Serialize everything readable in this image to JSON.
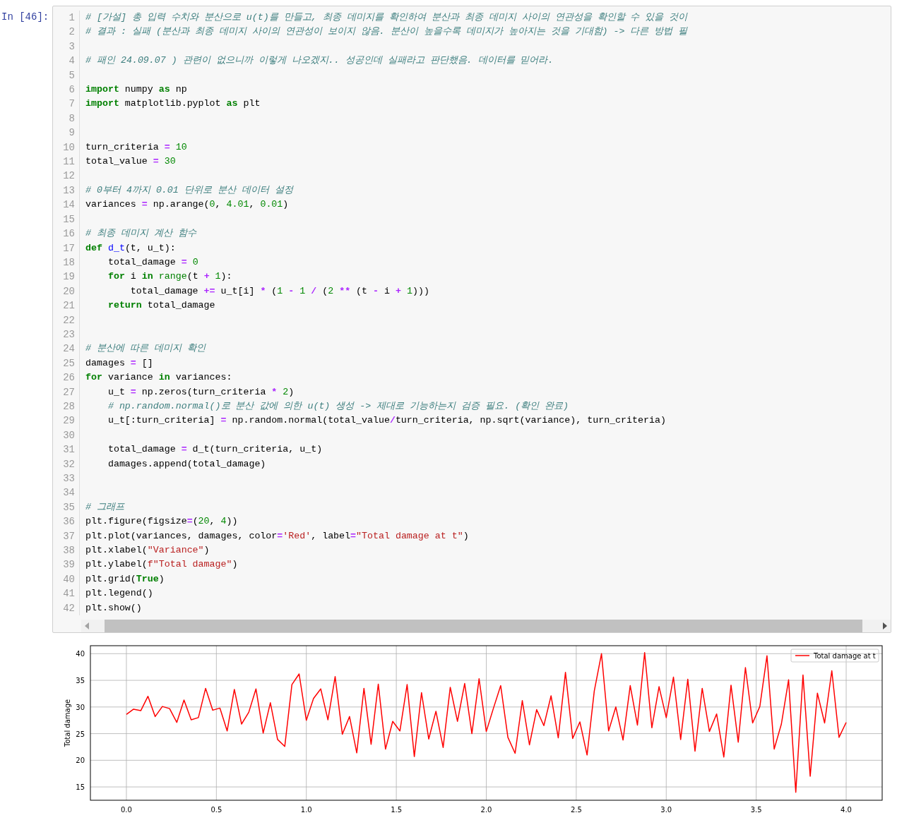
{
  "prompt": "In [46]:",
  "code": {
    "lines": [
      {
        "number": "1",
        "segments": [
          {
            "kind": "comment",
            "text": "# [가설] 총 입력 수치와 분산으로 u(t)를 만들고, 최종 데미지를 확인하여 분산과 최종 데미지 사이의 연관성을 확인할 수 있을 것이"
          }
        ]
      },
      {
        "number": "2",
        "segments": [
          {
            "kind": "comment",
            "text": "# 결과 : 실패 (분산과 최종 데미지 사이의 연관성이 보이지 않음. 분산이 높을수록 데미지가 높아지는 것을 기대함) -> 다른 방법 필"
          }
        ]
      },
      {
        "number": "3"
      },
      {
        "number": "4",
        "segments": [
          {
            "kind": "comment",
            "text": "# 패인 24.09.07 ) 관련이 없으니까 이렇게 나오겠지.. 성공인데 실패라고 판단했음. 데이터를 믿어라."
          }
        ]
      },
      {
        "number": "5"
      },
      {
        "number": "6",
        "segments": [
          {
            "kind": "keyword",
            "text": "import"
          },
          {
            "kind": "name",
            "text": " numpy "
          },
          {
            "kind": "keyword",
            "text": "as"
          },
          {
            "kind": "name",
            "text": " np"
          }
        ]
      },
      {
        "number": "7",
        "segments": [
          {
            "kind": "keyword",
            "text": "import"
          },
          {
            "kind": "name",
            "text": " matplotlib.pyplot "
          },
          {
            "kind": "keyword",
            "text": "as"
          },
          {
            "kind": "name",
            "text": " plt"
          }
        ]
      },
      {
        "number": "8"
      },
      {
        "number": "9"
      },
      {
        "number": "10",
        "segments": [
          {
            "kind": "name",
            "text": "turn_criteria "
          },
          {
            "kind": "operator",
            "text": "= "
          },
          {
            "kind": "number",
            "text": "10"
          }
        ]
      },
      {
        "number": "11",
        "segments": [
          {
            "kind": "name",
            "text": "total_value "
          },
          {
            "kind": "operator",
            "text": "= "
          },
          {
            "kind": "number",
            "text": "30"
          }
        ]
      },
      {
        "number": "12"
      },
      {
        "number": "13",
        "segments": [
          {
            "kind": "comment",
            "text": "# 0부터 4까지 0.01 단위로 분산 데이터 설정"
          }
        ]
      },
      {
        "number": "14",
        "segments": [
          {
            "kind": "name",
            "text": "variances "
          },
          {
            "kind": "operator",
            "text": "="
          },
          {
            "kind": "name",
            "text": " np.arange("
          },
          {
            "kind": "number",
            "text": "0"
          },
          {
            "kind": "name",
            "text": ", "
          },
          {
            "kind": "number",
            "text": "4.01"
          },
          {
            "kind": "name",
            "text": ", "
          },
          {
            "kind": "number",
            "text": "0.01"
          },
          {
            "kind": "name",
            "text": ")"
          }
        ]
      },
      {
        "number": "15"
      },
      {
        "number": "16",
        "segments": [
          {
            "kind": "comment",
            "text": "# 최종 데미지 계산 함수"
          }
        ]
      },
      {
        "number": "17",
        "segments": [
          {
            "kind": "keyword",
            "text": "def "
          },
          {
            "kind": "function",
            "text": "d_t"
          },
          {
            "kind": "name",
            "text": "(t, u_t):"
          }
        ]
      },
      {
        "number": "18",
        "segments": [
          {
            "kind": "name",
            "text": "    total_damage "
          },
          {
            "kind": "operator",
            "text": "= "
          },
          {
            "kind": "number",
            "text": "0"
          }
        ]
      },
      {
        "number": "19",
        "segments": [
          {
            "kind": "keyword",
            "text": "    for"
          },
          {
            "kind": "name",
            "text": " i "
          },
          {
            "kind": "keyword",
            "text": "in "
          },
          {
            "kind": "builtin",
            "text": "range"
          },
          {
            "kind": "name",
            "text": "(t "
          },
          {
            "kind": "operator",
            "text": "+ "
          },
          {
            "kind": "number",
            "text": "1"
          },
          {
            "kind": "name",
            "text": "):"
          }
        ]
      },
      {
        "number": "20",
        "segments": [
          {
            "kind": "name",
            "text": "        total_damage "
          },
          {
            "kind": "operator",
            "text": "+="
          },
          {
            "kind": "name",
            "text": " u_t[i] "
          },
          {
            "kind": "operator",
            "text": "*"
          },
          {
            "kind": "name",
            "text": " ("
          },
          {
            "kind": "number",
            "text": "1 "
          },
          {
            "kind": "operator",
            "text": "- "
          },
          {
            "kind": "number",
            "text": "1 "
          },
          {
            "kind": "operator",
            "text": "/"
          },
          {
            "kind": "name",
            "text": " ("
          },
          {
            "kind": "number",
            "text": "2 "
          },
          {
            "kind": "operator",
            "text": "**"
          },
          {
            "kind": "name",
            "text": " (t "
          },
          {
            "kind": "operator",
            "text": "-"
          },
          {
            "kind": "name",
            "text": " i "
          },
          {
            "kind": "operator",
            "text": "+ "
          },
          {
            "kind": "number",
            "text": "1"
          },
          {
            "kind": "name",
            "text": ")))"
          }
        ]
      },
      {
        "number": "21",
        "segments": [
          {
            "kind": "keyword",
            "text": "    return"
          },
          {
            "kind": "name",
            "text": " total_damage"
          }
        ]
      },
      {
        "number": "22"
      },
      {
        "number": "23"
      },
      {
        "number": "24",
        "segments": [
          {
            "kind": "comment",
            "text": "# 분산에 따른 데미지 확인"
          }
        ]
      },
      {
        "number": "25",
        "segments": [
          {
            "kind": "name",
            "text": "damages "
          },
          {
            "kind": "operator",
            "text": "="
          },
          {
            "kind": "name",
            "text": " []"
          }
        ]
      },
      {
        "number": "26",
        "segments": [
          {
            "kind": "keyword",
            "text": "for"
          },
          {
            "kind": "name",
            "text": " variance "
          },
          {
            "kind": "keyword",
            "text": "in"
          },
          {
            "kind": "name",
            "text": " variances:"
          }
        ]
      },
      {
        "number": "27",
        "segments": [
          {
            "kind": "name",
            "text": "    u_t "
          },
          {
            "kind": "operator",
            "text": "="
          },
          {
            "kind": "name",
            "text": " np.zeros(turn_criteria "
          },
          {
            "kind": "operator",
            "text": "* "
          },
          {
            "kind": "number",
            "text": "2"
          },
          {
            "kind": "name",
            "text": ")"
          }
        ]
      },
      {
        "number": "28",
        "segments": [
          {
            "kind": "comment",
            "text": "    # np.random.normal()로 분산 값에 의한 u(t) 생성 -> 제대로 기능하는지 검증 필요. (확인 완료)"
          }
        ]
      },
      {
        "number": "29",
        "segments": [
          {
            "kind": "name",
            "text": "    u_t[:turn_criteria] "
          },
          {
            "kind": "operator",
            "text": "="
          },
          {
            "kind": "name",
            "text": " np.random.normal(total_value"
          },
          {
            "kind": "operator",
            "text": "/"
          },
          {
            "kind": "name",
            "text": "turn_criteria, np.sqrt(variance), turn_criteria)"
          }
        ]
      },
      {
        "number": "30"
      },
      {
        "number": "31",
        "segments": [
          {
            "kind": "name",
            "text": "    total_damage "
          },
          {
            "kind": "operator",
            "text": "="
          },
          {
            "kind": "name",
            "text": " d_t(turn_criteria, u_t)"
          }
        ]
      },
      {
        "number": "32",
        "segments": [
          {
            "kind": "name",
            "text": "    damages.append(total_damage)"
          }
        ]
      },
      {
        "number": "33"
      },
      {
        "number": "34"
      },
      {
        "number": "35",
        "segments": [
          {
            "kind": "comment",
            "text": "# 그래프"
          }
        ]
      },
      {
        "number": "36",
        "segments": [
          {
            "kind": "name",
            "text": "plt.figure(figsize"
          },
          {
            "kind": "operator",
            "text": "="
          },
          {
            "kind": "name",
            "text": "("
          },
          {
            "kind": "number",
            "text": "20"
          },
          {
            "kind": "name",
            "text": ", "
          },
          {
            "kind": "number",
            "text": "4"
          },
          {
            "kind": "name",
            "text": "))"
          }
        ]
      },
      {
        "number": "37",
        "segments": [
          {
            "kind": "name",
            "text": "plt.plot(variances, damages, color"
          },
          {
            "kind": "operator",
            "text": "="
          },
          {
            "kind": "string",
            "text": "'Red'"
          },
          {
            "kind": "name",
            "text": ", label"
          },
          {
            "kind": "operator",
            "text": "="
          },
          {
            "kind": "string",
            "text": "\"Total damage at t\""
          },
          {
            "kind": "name",
            "text": ")"
          }
        ]
      },
      {
        "number": "38",
        "segments": [
          {
            "kind": "name",
            "text": "plt.xlabel("
          },
          {
            "kind": "string",
            "text": "\"Variance\""
          },
          {
            "kind": "name",
            "text": ")"
          }
        ]
      },
      {
        "number": "39",
        "segments": [
          {
            "kind": "name",
            "text": "plt.ylabel("
          },
          {
            "kind": "string",
            "text": "f\"Total damage\""
          },
          {
            "kind": "name",
            "text": ")"
          }
        ]
      },
      {
        "number": "40",
        "segments": [
          {
            "kind": "name",
            "text": "plt.grid("
          },
          {
            "kind": "keyword",
            "text": "True"
          },
          {
            "kind": "name",
            "text": ")"
          }
        ]
      },
      {
        "number": "41",
        "segments": [
          {
            "kind": "name",
            "text": "plt.legend()"
          }
        ]
      },
      {
        "number": "42",
        "segments": [
          {
            "kind": "name",
            "text": "plt.show()"
          }
        ]
      }
    ]
  },
  "output": {
    "chart_data": {
      "type": "line",
      "grid": true,
      "ylabel": "Total damage",
      "xlim": [
        -0.2,
        4.2
      ],
      "ylim": [
        12.5,
        41.5
      ],
      "xticks": [
        {
          "value": 0,
          "label": "0.0"
        },
        {
          "value": 0.5,
          "label": "0.5"
        },
        {
          "value": 1,
          "label": "1.0"
        },
        {
          "value": 1.5,
          "label": "1.5"
        },
        {
          "value": 2,
          "label": "2.0"
        },
        {
          "value": 2.5,
          "label": "2.5"
        },
        {
          "value": 3,
          "label": "3.0"
        },
        {
          "value": 3.5,
          "label": "3.5"
        },
        {
          "value": 4,
          "label": "4.0"
        }
      ],
      "yticks": [
        15,
        20,
        25,
        30,
        35,
        40
      ],
      "x": [
        0,
        0.04,
        0.08,
        0.12,
        0.16,
        0.2,
        0.24,
        0.28,
        0.32,
        0.36,
        0.4,
        0.44,
        0.48,
        0.52,
        0.56,
        0.6,
        0.64,
        0.68,
        0.72,
        0.76,
        0.8,
        0.84,
        0.88,
        0.92,
        0.96,
        1,
        1.04,
        1.08,
        1.12,
        1.16,
        1.2,
        1.24,
        1.28,
        1.32,
        1.36,
        1.4,
        1.44,
        1.48,
        1.52,
        1.56,
        1.6,
        1.64,
        1.68,
        1.72,
        1.76,
        1.8,
        1.84,
        1.88,
        1.92,
        1.96,
        2,
        2.04,
        2.08,
        2.12,
        2.16,
        2.2,
        2.24,
        2.28,
        2.32,
        2.36,
        2.4,
        2.44,
        2.48,
        2.52,
        2.56,
        2.6,
        2.64,
        2.68,
        2.72,
        2.76,
        2.8,
        2.84,
        2.88,
        2.92,
        2.96,
        3,
        3.04,
        3.08,
        3.12,
        3.16,
        3.2,
        3.24,
        3.28,
        3.32,
        3.36,
        3.4,
        3.44,
        3.48,
        3.52,
        3.56,
        3.6,
        3.64,
        3.68,
        3.72,
        3.76,
        3.8,
        3.84,
        3.88,
        3.92,
        3.96,
        4
      ],
      "series": [
        {
          "name": "Total damage at t",
          "color": "#ff0000",
          "values": [
            28.6,
            29.6,
            29.3,
            32.0,
            28.2,
            30.1,
            29.7,
            27.1,
            31.3,
            27.6,
            28.0,
            33.5,
            29.4,
            29.8,
            25.5,
            33.3,
            26.8,
            29.0,
            33.4,
            25.1,
            30.8,
            23.9,
            22.6,
            34.2,
            36.2,
            27.5,
            31.6,
            33.4,
            27.6,
            35.7,
            24.9,
            28.2,
            21.4,
            33.5,
            23.0,
            34.3,
            22.1,
            27.3,
            25.5,
            34.2,
            20.7,
            32.7,
            24.0,
            29.2,
            22.4,
            33.7,
            27.3,
            34.4,
            25.0,
            35.3,
            25.4,
            29.8,
            34.0,
            24.3,
            21.3,
            31.2,
            22.9,
            29.5,
            26.5,
            32.1,
            24.2,
            36.5,
            24.1,
            27.2,
            21.0,
            33.0,
            40.0,
            25.5,
            30.0,
            23.8,
            34.0,
            26.6,
            40.2,
            26.1,
            33.8,
            28.0,
            35.6,
            23.9,
            35.2,
            21.7,
            33.5,
            25.4,
            28.7,
            20.6,
            34.1,
            23.4,
            37.4,
            27.0,
            30.1,
            39.6,
            22.1,
            26.8,
            35.1,
            14.0,
            36.0,
            17.0,
            32.6,
            27.0,
            36.8,
            24.3,
            27.1
          ]
        }
      ]
    }
  }
}
